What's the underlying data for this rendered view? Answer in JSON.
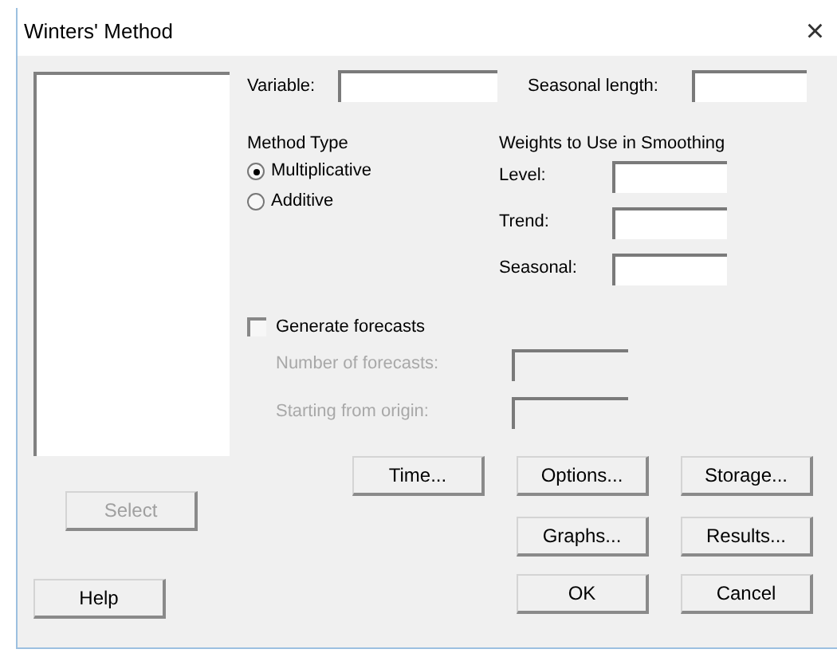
{
  "window": {
    "title": "Winters' Method",
    "close": "×"
  },
  "variable": {
    "label": "Variable:"
  },
  "seasonal_length": {
    "label": "Seasonal length:"
  },
  "method_type": {
    "header": "Method Type",
    "options": [
      {
        "label": "Multiplicative",
        "selected": true
      },
      {
        "label": "Additive",
        "selected": false
      }
    ]
  },
  "weights": {
    "header": "Weights to Use in Smoothing",
    "fields": [
      {
        "label": "Level:"
      },
      {
        "label": "Trend:"
      },
      {
        "label": "Seasonal:"
      }
    ]
  },
  "generate_forecasts": {
    "label": "Generate forecasts",
    "checked": false
  },
  "forecast_fields": [
    {
      "label": "Number of forecasts:",
      "disabled": true
    },
    {
      "label": "Starting from origin:",
      "disabled": true
    }
  ],
  "select_button": {
    "label": "Select",
    "disabled": true
  },
  "help_button": {
    "label": "Help"
  },
  "buttons": [
    {
      "label": "Time..."
    },
    {
      "label": "Options..."
    },
    {
      "label": "Storage..."
    },
    {
      "label": "Graphs..."
    },
    {
      "label": "Results..."
    },
    {
      "label": "OK"
    },
    {
      "label": "Cancel"
    }
  ]
}
